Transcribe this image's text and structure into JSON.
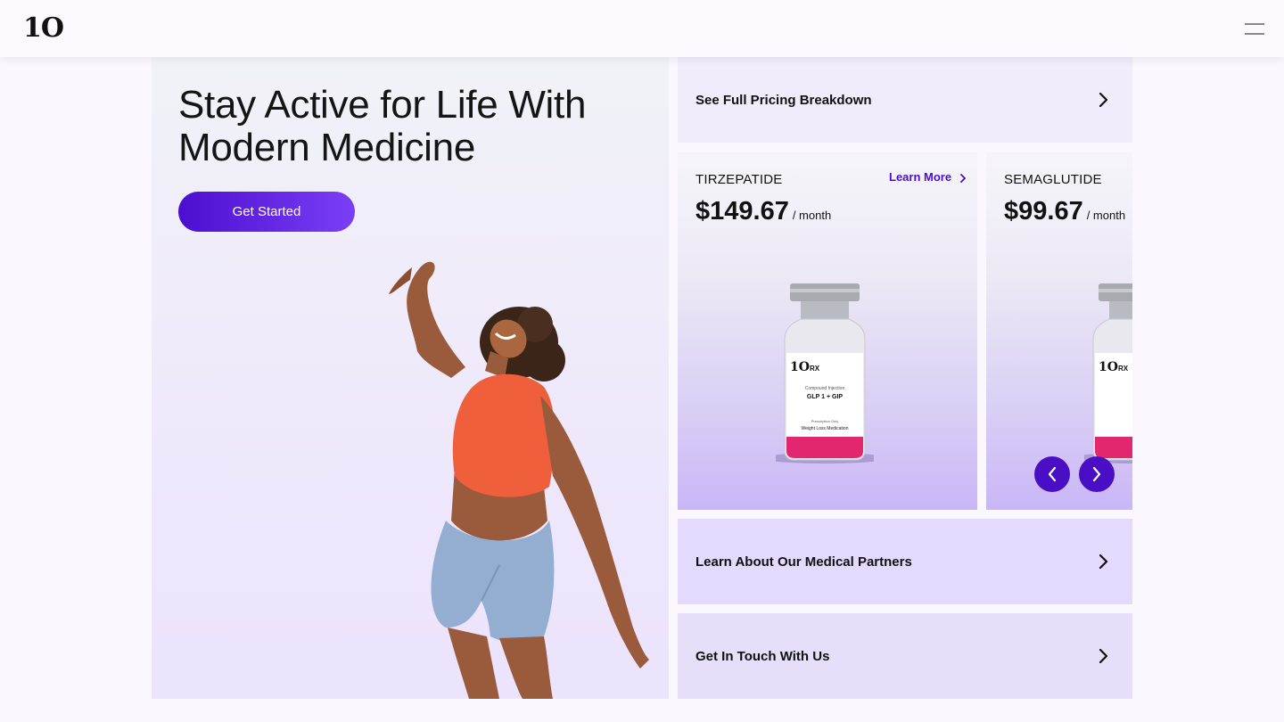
{
  "header": {
    "logo_text": "1O",
    "menu_icon": "hamburger-menu-icon"
  },
  "hero": {
    "title": "Stay Active for Life With Modern Medicine",
    "cta_label": "Get Started",
    "image": "woman-dancing-photo"
  },
  "links": {
    "pricing_label": "See Full Pricing Breakdown",
    "partners_label": "Learn About Our Medical Partners",
    "contact_label": "Get In Touch With Us",
    "chevron_icon": "chevron-right-icon"
  },
  "products": [
    {
      "name": "TIRZEPATIDE",
      "price": "$149.67",
      "period": "/ month",
      "learn_more": "Learn More",
      "vial_brand": "1O",
      "vial_rx": "RX",
      "vial_line1": "Compound Injection",
      "vial_line2": "GLP 1 + GIP",
      "vial_line3": "Prescription Only",
      "vial_line4": "Weight Loss Medication"
    },
    {
      "name": "SEMAGLUTIDE",
      "price": "$99.67",
      "period": "/ month",
      "vial_brand": "1O",
      "vial_rx": "RX"
    }
  ],
  "carousel": {
    "prev_icon": "arrow-left-icon",
    "next_icon": "arrow-right-icon"
  },
  "colors": {
    "accent": "#4a10c8",
    "accent_light": "#7a3ff6",
    "card_bg": "#e4dafd"
  }
}
